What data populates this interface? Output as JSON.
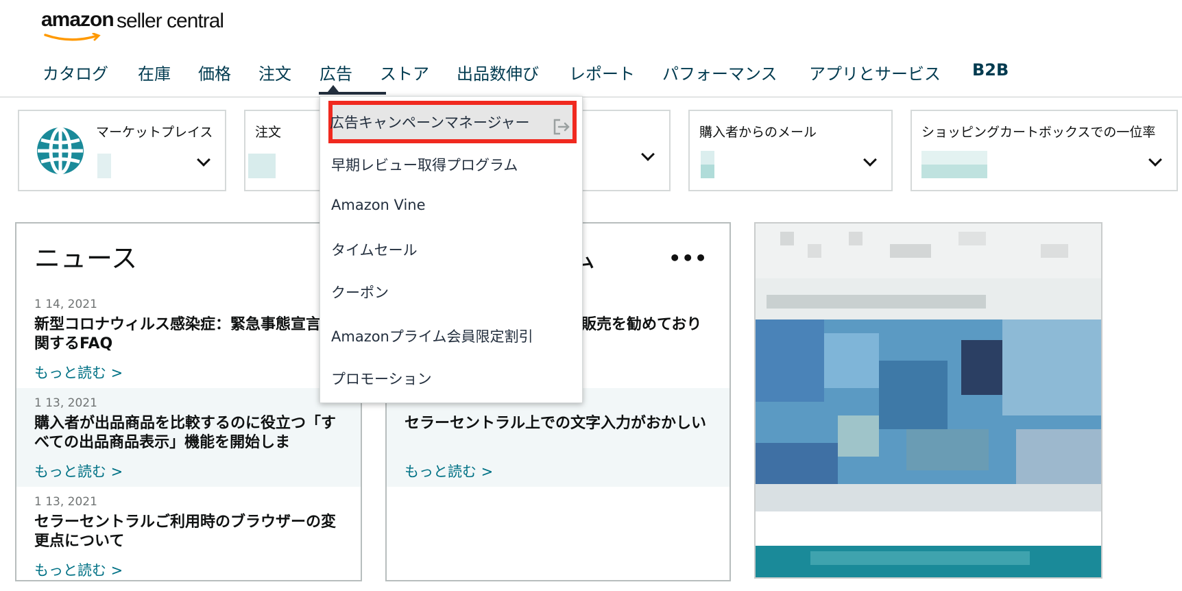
{
  "logo": {
    "brand": "amazon",
    "product": "seller central"
  },
  "nav": {
    "items": [
      "カタログ",
      "在庫",
      "価格",
      "注文",
      "広告",
      "ストア",
      "出品数伸び",
      "レポート",
      "パフォーマンス",
      "アプリとサービス",
      "B2B"
    ],
    "active": "広告"
  },
  "cards": {
    "marketplace": {
      "title": "マーケットプレイス",
      "icon": "globe-icon"
    },
    "orders": {
      "title": "注文"
    },
    "buyer_messages": {
      "title": "購入者からのメール"
    },
    "buy_box": {
      "title": "ショッピングカートボックスでの一位率"
    }
  },
  "news": {
    "title": "ニュース",
    "items": [
      {
        "date": "1 14, 2021",
        "headline": "新型コロナウィルス感染症：緊急事態宣言に関するFAQ",
        "more": "もっと読む >"
      },
      {
        "date": "1 13, 2021",
        "headline": "購入者が出品商品を比較するのに役立つ「すべての出品商品表示」機能を開始しま",
        "more": "もっと読む >"
      },
      {
        "date": "1 13, 2021",
        "headline": "セラーセントラルご利用時のブラウザーの変更点について",
        "more": "もっと読む >"
      }
    ]
  },
  "second_panel": {
    "title_fragment": "ム",
    "more_icon": "more-dots-icon",
    "items": [
      {
        "headline": "販売を勧めており"
      },
      {
        "headline": "セラーセントラル上での文字入力がおかしい",
        "more": "もっと読む >"
      }
    ]
  },
  "dropdown": {
    "items": [
      {
        "label": "広告キャンペーンマネージャー",
        "icon": "external-link-icon",
        "highlighted": true
      },
      {
        "label": "早期レビュー取得プログラム"
      },
      {
        "label": "Amazon Vine"
      },
      {
        "label": "タイムセール"
      },
      {
        "label": "クーポン"
      },
      {
        "label": "Amazonプライム会員限定割引"
      },
      {
        "label": "プロモーション"
      }
    ]
  },
  "colors": {
    "nav_text": "#003a4f",
    "link": "#007185",
    "highlight_border": "#f0291f",
    "teal": "#1a8a99"
  }
}
